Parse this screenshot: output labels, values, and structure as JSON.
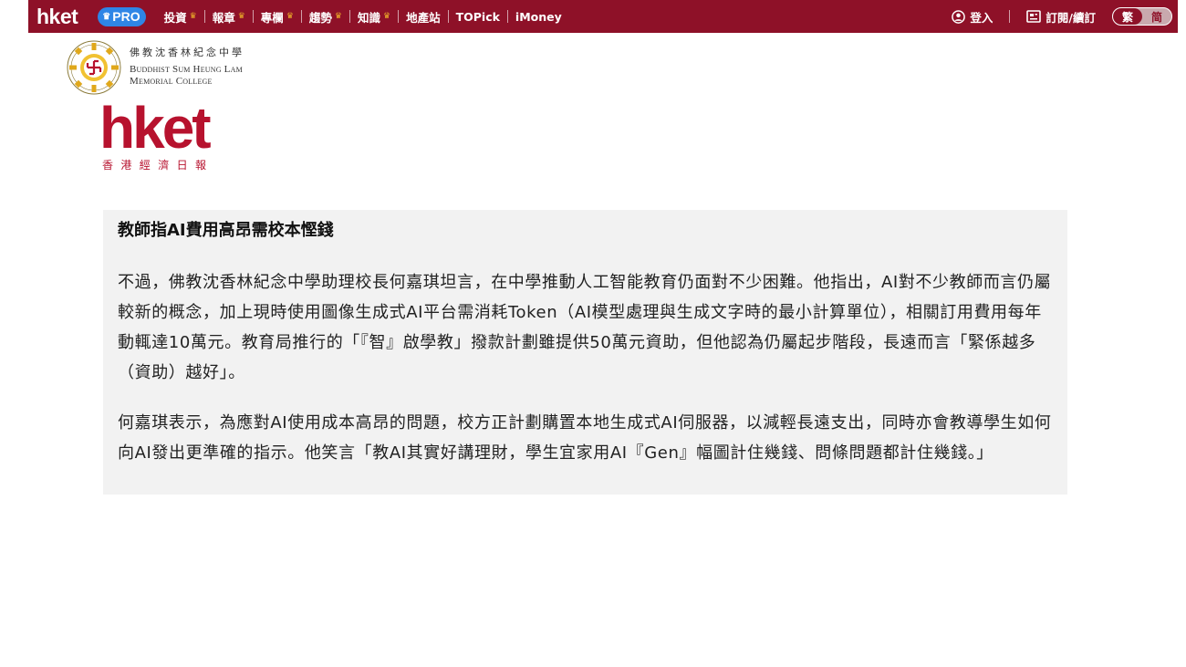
{
  "topbar": {
    "brand": "hket",
    "pro_label": "PRO",
    "nav": [
      {
        "label": "投資",
        "premium": true
      },
      {
        "label": "報章",
        "premium": true
      },
      {
        "label": "專欄",
        "premium": true
      },
      {
        "label": "趨勢",
        "premium": true
      },
      {
        "label": "知識",
        "premium": true
      },
      {
        "label": "地產站",
        "premium": false
      },
      {
        "label": "TOPick",
        "premium": false
      },
      {
        "label": "iMoney",
        "premium": false
      }
    ],
    "login_label": "登入",
    "subscribe_label": "訂閱/續訂",
    "lang_traditional": "繁",
    "lang_simplified": "简",
    "colors": {
      "bar": "#8e1128",
      "pro": "#2f86e6",
      "crown": "#f0b429"
    }
  },
  "school": {
    "name_zh": "佛教沈香林紀念中學",
    "name_en_line1": "Buddhist Sum Heung Lam",
    "name_en_line2": "Memorial College"
  },
  "logo": {
    "word": "hket",
    "sub": "香港經濟日報",
    "color": "#b7122e"
  },
  "article": {
    "heading": "教師指AI費用高昂需校本慳錢",
    "paragraph1": "不過，佛教沈香林紀念中學助理校長何嘉琪坦言，在中學推動人工智能教育仍面對不少困難。他指出，AI對不少教師而言仍屬較新的概念，加上現時使用圖像生成式AI平台需消耗Token（AI模型處理與生成文字時的最小計算單位），相關訂用費用每年動輒達10萬元。教育局推行的「『智』啟學教」撥款計劃雖提供50萬元資助，但他認為仍屬起步階段，長遠而言「緊係越多（資助）越好」。",
    "paragraph2": "何嘉琪表示，為應對AI使用成本高昂的問題，校方正計劃購置本地生成式AI伺服器，以減輕長遠支出，同時亦會教導學生如何向AI發出更準確的指示。他笑言「教AI其實好講理財，學生宜家用AI『Gen』幅圖計住幾錢、問條問題都計住幾錢。」"
  }
}
